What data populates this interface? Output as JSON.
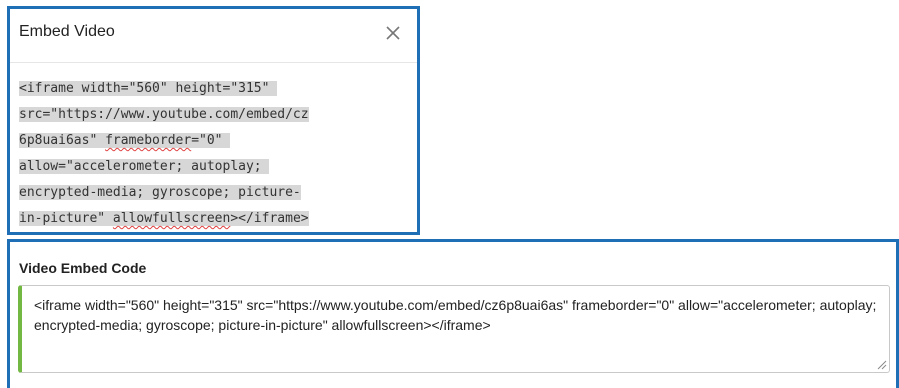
{
  "dialog": {
    "title": "Embed Video",
    "close_icon": "close-icon",
    "code_lines": [
      [
        {
          "t": "<iframe width=\"560\" height=\"315\" "
        }
      ],
      [
        {
          "t": "src=\"https://www.youtube.com/embed/cz"
        }
      ],
      [
        {
          "t": "6p8uai6as\" "
        },
        {
          "t": "frameborder",
          "s": true
        },
        {
          "t": "=\"0\" "
        }
      ],
      [
        {
          "t": "allow=\"accelerometer; autoplay; "
        }
      ],
      [
        {
          "t": "encrypted-media; gyroscope; picture-"
        }
      ],
      [
        {
          "t": "in-picture\" "
        },
        {
          "t": "allowfullscreen",
          "s": true
        },
        {
          "t": "></iframe>"
        }
      ]
    ]
  },
  "embed_panel": {
    "label": "Video Embed Code",
    "value": "<iframe width=\"560\" height=\"315\" src=\"https://www.youtube.com/embed/cz6p8uai6as\" frameborder=\"0\" allow=\"accelerometer; autoplay; encrypted-media; gyroscope; picture-in-picture\" allowfullscreen></iframe>",
    "accent_color": "#72b843"
  },
  "colors": {
    "border_blue": "#1f6fb7",
    "selection_gray": "#d7d7d7",
    "spellcheck_red": "#e04040"
  }
}
